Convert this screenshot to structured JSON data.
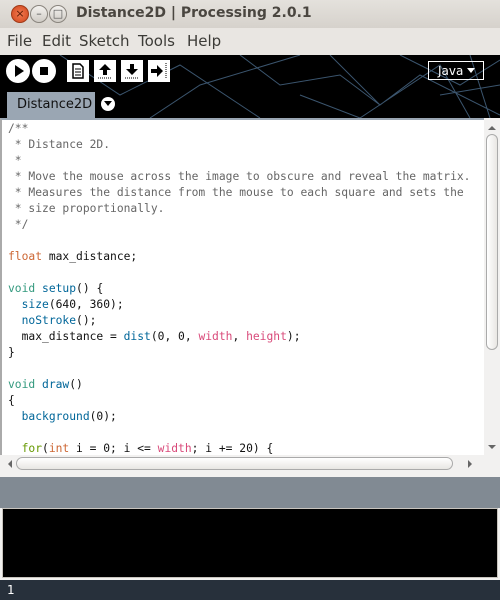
{
  "window": {
    "title": "Distance2D | Processing 2.0.1"
  },
  "menu": [
    "File",
    "Edit",
    "Sketch",
    "Tools",
    "Help"
  ],
  "toolbar": {
    "buttons": [
      "run",
      "stop",
      "new",
      "open",
      "save",
      "export"
    ],
    "mode": "Java"
  },
  "tabs": [
    {
      "label": "Distance2D"
    }
  ],
  "colors": {
    "keyword": "#cc6633",
    "void": "#33997e",
    "function": "#006699",
    "constant": "#d94a7a",
    "control": "#669900",
    "comment": "#666666"
  },
  "code": [
    [
      [
        "comment",
        "/**"
      ]
    ],
    [
      [
        "comment",
        " * Distance 2D."
      ]
    ],
    [
      [
        "comment",
        " *"
      ]
    ],
    [
      [
        "comment",
        " * Move the mouse across the image to obscure and reveal the matrix."
      ]
    ],
    [
      [
        "comment",
        " * Measures the distance from the mouse to each square and sets the"
      ]
    ],
    [
      [
        "comment",
        " * size proportionally."
      ]
    ],
    [
      [
        "comment",
        " */"
      ]
    ],
    [
      [
        "plain",
        ""
      ]
    ],
    [
      [
        "keyword",
        "float"
      ],
      [
        "plain",
        " max_distance;"
      ]
    ],
    [
      [
        "plain",
        ""
      ]
    ],
    [
      [
        "void",
        "void"
      ],
      [
        "plain",
        " "
      ],
      [
        "function",
        "setup"
      ],
      [
        "plain",
        "() {"
      ]
    ],
    [
      [
        "plain",
        "  "
      ],
      [
        "function",
        "size"
      ],
      [
        "plain",
        "(640, 360);"
      ]
    ],
    [
      [
        "plain",
        "  "
      ],
      [
        "function",
        "noStroke"
      ],
      [
        "plain",
        "();"
      ]
    ],
    [
      [
        "plain",
        "  max_distance = "
      ],
      [
        "function",
        "dist"
      ],
      [
        "plain",
        "(0, 0, "
      ],
      [
        "constant",
        "width"
      ],
      [
        "plain",
        ", "
      ],
      [
        "constant",
        "height"
      ],
      [
        "plain",
        ");"
      ]
    ],
    [
      [
        "plain",
        "}"
      ]
    ],
    [
      [
        "plain",
        ""
      ]
    ],
    [
      [
        "void",
        "void"
      ],
      [
        "plain",
        " "
      ],
      [
        "function",
        "draw"
      ],
      [
        "plain",
        "()"
      ]
    ],
    [
      [
        "plain",
        "{"
      ]
    ],
    [
      [
        "plain",
        "  "
      ],
      [
        "function",
        "background"
      ],
      [
        "plain",
        "(0);"
      ]
    ],
    [
      [
        "plain",
        ""
      ]
    ],
    [
      [
        "plain",
        "  "
      ],
      [
        "control",
        "for"
      ],
      [
        "plain",
        "("
      ],
      [
        "keyword",
        "int"
      ],
      [
        "plain",
        " i = 0; i <= "
      ],
      [
        "constant",
        "width"
      ],
      [
        "plain",
        "; i += 20) {"
      ]
    ]
  ],
  "status": {
    "line": "1"
  }
}
